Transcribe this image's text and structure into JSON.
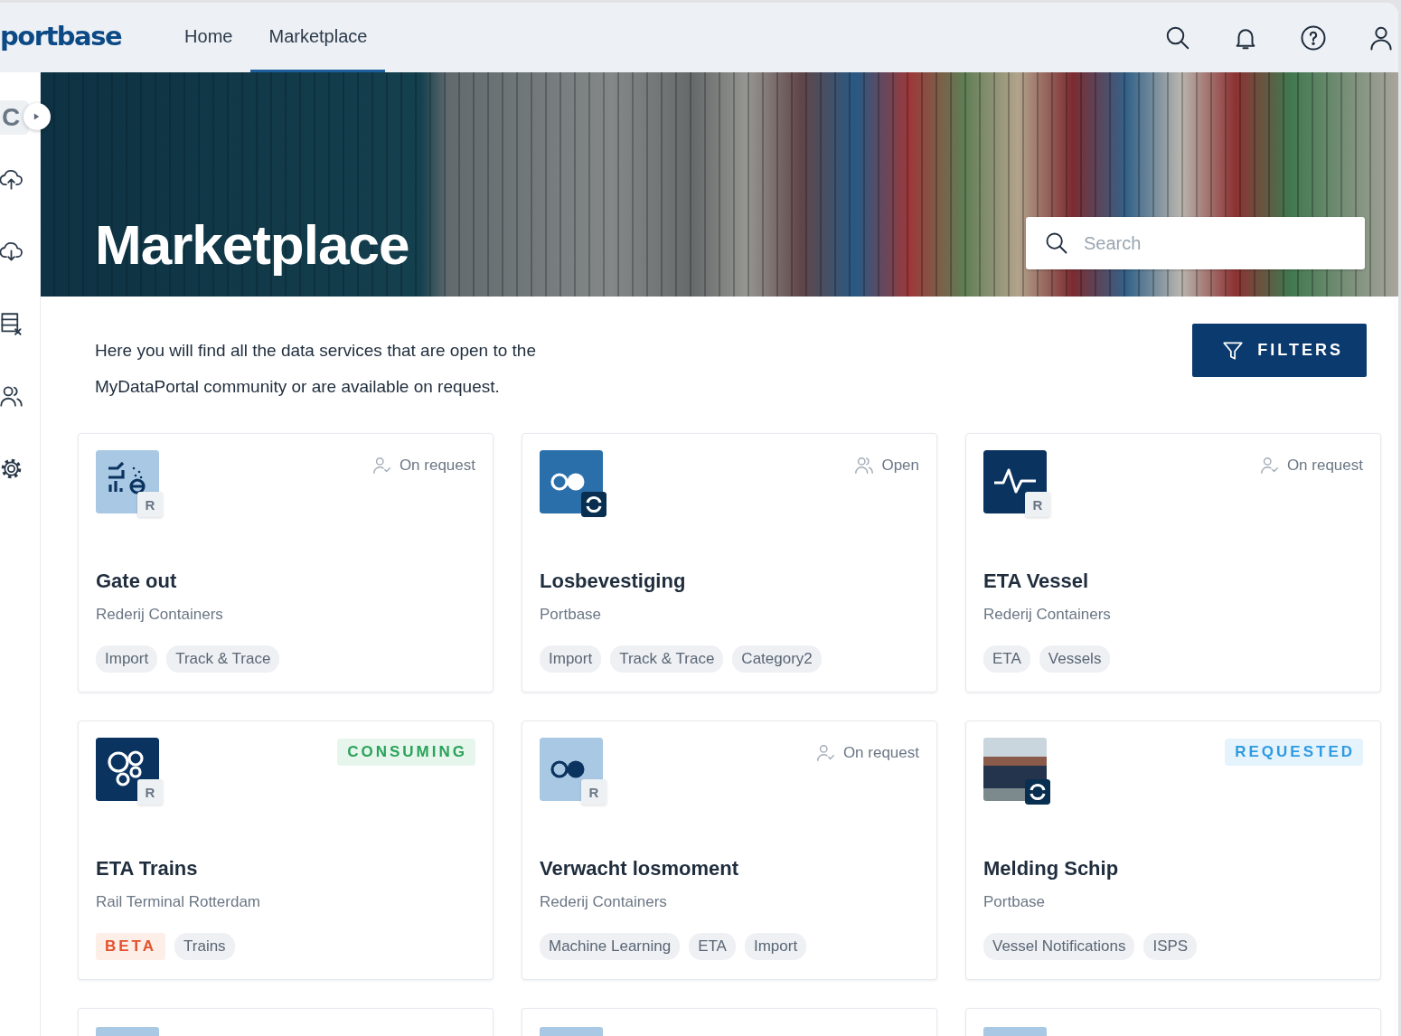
{
  "logo": "portbase",
  "nav": [
    {
      "label": "Home",
      "selected": false
    },
    {
      "label": "Marketplace",
      "selected": true
    }
  ],
  "sidebar": {
    "collapsed_label": "C",
    "items": [
      {
        "kind": "upload"
      },
      {
        "kind": "download"
      },
      {
        "kind": "table"
      },
      {
        "kind": "users"
      },
      {
        "kind": "settings"
      }
    ]
  },
  "hero": {
    "title": "Marketplace",
    "search": {
      "placeholder": "Search"
    }
  },
  "intro": "Here you will find all the data services that are open to the MyDataPortal community or are available on request.",
  "filters_button": "FILTERS",
  "cards": [
    {
      "kind": "full",
      "badge": {
        "kind": "letter",
        "label": "R"
      },
      "access": {
        "kind": "on_request",
        "label": "On request"
      },
      "title": "Gate out",
      "provider": "Rederij Containers",
      "tags": [
        {
          "kind": "plain",
          "label": "Import"
        },
        {
          "kind": "plain",
          "label": "Track & Trace"
        }
      ]
    },
    {
      "kind": "full",
      "badge": {
        "kind": "sync"
      },
      "access": {
        "kind": "open",
        "label": "Open"
      },
      "title": "Losbevestiging",
      "provider": "Portbase",
      "tags": [
        {
          "kind": "plain",
          "label": "Import"
        },
        {
          "kind": "plain",
          "label": "Track & Trace"
        },
        {
          "kind": "plain",
          "label": "Category2"
        }
      ]
    },
    {
      "kind": "full",
      "badge": {
        "kind": "letter",
        "label": "R"
      },
      "access": {
        "kind": "on_request",
        "label": "On request"
      },
      "title": "ETA Vessel",
      "provider": "Rederij Containers",
      "tags": [
        {
          "kind": "plain",
          "label": "ETA"
        },
        {
          "kind": "plain",
          "label": "Vessels"
        }
      ]
    },
    {
      "kind": "full",
      "badge": {
        "kind": "letter",
        "label": "R"
      },
      "access": {
        "kind": "consuming",
        "label": "CONSUMING"
      },
      "title": "ETA Trains",
      "provider": "Rail Terminal Rotterdam",
      "tags": [
        {
          "kind": "beta",
          "label": "BETA"
        },
        {
          "kind": "plain",
          "label": "Trains"
        }
      ]
    },
    {
      "kind": "full",
      "badge": {
        "kind": "letter",
        "label": "R"
      },
      "access": {
        "kind": "on_request",
        "label": "On request"
      },
      "title": "Verwacht losmoment",
      "provider": "Rederij Containers",
      "tags": [
        {
          "kind": "plain",
          "label": "Machine Learning"
        },
        {
          "kind": "plain",
          "label": "ETA"
        },
        {
          "kind": "plain",
          "label": "Import"
        }
      ]
    },
    {
      "kind": "full",
      "badge": {
        "kind": "sync"
      },
      "access": {
        "kind": "requested",
        "label": "REQUESTED"
      },
      "title": "Melding Schip",
      "provider": "Portbase",
      "tags": [
        {
          "kind": "plain",
          "label": "Vessel Notifications"
        },
        {
          "kind": "plain",
          "label": "ISPS"
        }
      ]
    },
    {
      "kind": "partial"
    },
    {
      "kind": "partial"
    },
    {
      "kind": "partial"
    }
  ]
}
